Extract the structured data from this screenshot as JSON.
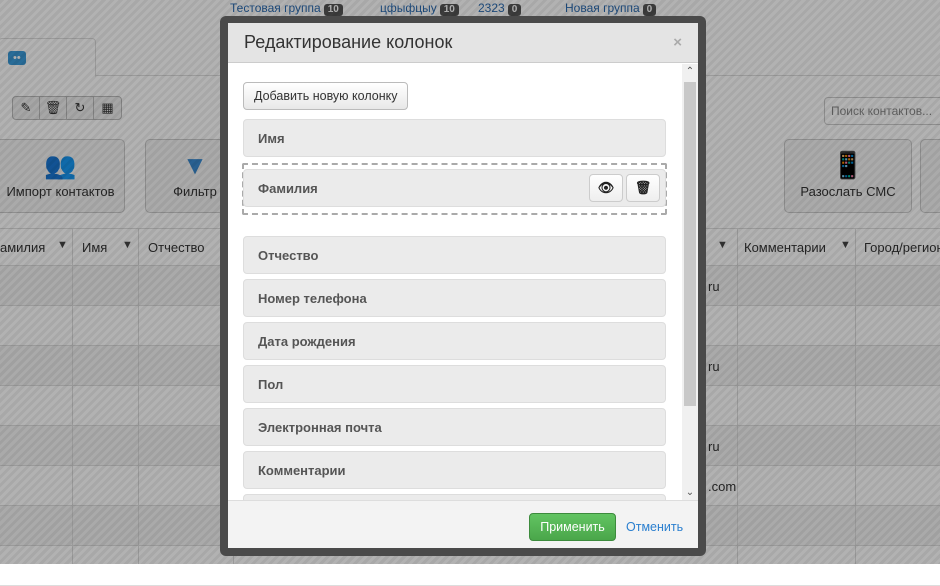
{
  "background": {
    "groups": [
      {
        "label": "Тестовая группа",
        "count": "10"
      },
      {
        "label": "цфыфцыу",
        "count": "10"
      },
      {
        "label": "2323",
        "count": "0"
      },
      {
        "label": "Новая группа",
        "count": "0"
      }
    ],
    "search_placeholder": "Поиск контактов...",
    "buttons": {
      "import": "Импорт контактов",
      "filter": "Фильтр",
      "sms": "Разослать СМС"
    },
    "columns": [
      "амилия",
      "Имя",
      "Отчество",
      "Комментарии",
      "Город/регион"
    ],
    "cell_fragments": [
      "ru",
      "ru",
      "ru",
      ".com"
    ]
  },
  "modal": {
    "title": "Редактирование колонок",
    "close": "×",
    "add_column": "Добавить новую колонку",
    "columns": [
      "Имя",
      "Фамилия",
      "Отчество",
      "Номер телефона",
      "Дата рождения",
      "Пол",
      "Электронная почта",
      "Комментарии"
    ],
    "apply": "Применить",
    "cancel": "Отменить"
  },
  "colors": {
    "apply": "#5cb85c",
    "link": "#2a7fcf"
  }
}
